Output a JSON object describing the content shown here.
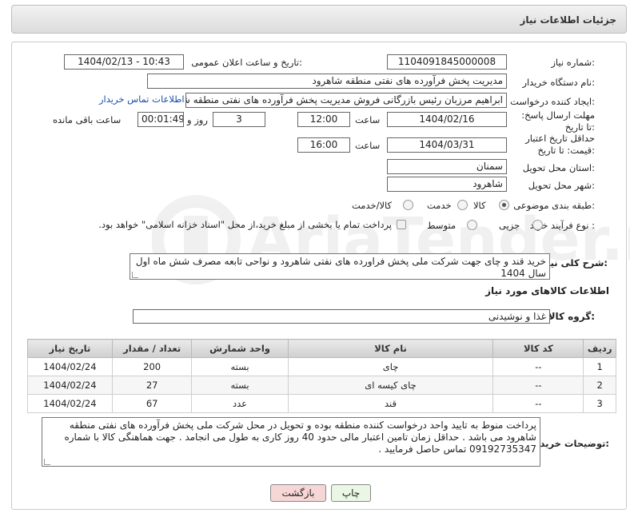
{
  "header": {
    "title": "جزئیات اطلاعات نیاز"
  },
  "watermark": {
    "text": "AriaTender.net"
  },
  "fields": {
    "need_number_label": "شماره نیاز:",
    "need_number": "1104091845000008",
    "announce_label": "تاریخ و ساعت اعلان عمومی:",
    "announce_value": "1404/02/13 - 10:43",
    "buyer_org_label": "نام دستگاه خریدار:",
    "buyer_org": "مدیریت پخش فرآورده های نفتی منطقه شاهرود",
    "creator_label": "ایجاد کننده درخواست:",
    "creator": "ابراهیم مرزبان رئیس بازرگانی فروش مدیریت پخش فرآورده های نفتی منطقه شا",
    "contact_link": "اطلاعات تماس خریدار",
    "deadline_label": "مهلت ارسال پاسخ: تا تاریخ:",
    "deadline_date": "1404/02/16",
    "time_label": "ساعت",
    "deadline_time": "12:00",
    "days_value": "3",
    "days_label": "روز و",
    "remaining_time": "00:01:49",
    "remaining_label": "ساعت باقی مانده",
    "validity_label": "حداقل تاریخ اعتبار قیمت: تا تاریخ:",
    "validity_date": "1404/03/31",
    "validity_time": "16:00",
    "province_label": "استان محل تحویل:",
    "province": "سمنان",
    "city_label": "شهر محل تحویل:",
    "city": "شاهرود",
    "category_label": "طبقه بندی موضوعی:",
    "category_options": [
      "کالا",
      "خدمت",
      "کالا/خدمت"
    ],
    "category_selected": "کالا",
    "process_label": "نوع فرآیند خرید :",
    "process_options": [
      "جزیی",
      "متوسط"
    ],
    "process_note": "پرداخت تمام یا بخشی از مبلغ خرید،از محل \"اسناد خزانه اسلامی\" خواهد بود.",
    "description_label": "شرح کلی نیاز:",
    "description": "خرید قند و چای جهت شرکت ملی پخش فراورده های نفتی شاهرود و نواحی تابعه مصرف شش ماه اول سال 1404",
    "goods_section_title": "اطلاعات کالاهای مورد نیاز",
    "goods_group_label": "گروه کالا:",
    "goods_group": "غذا و نوشیدنی",
    "buyer_notes_label": "توضیحات خریدار:",
    "buyer_notes": "پرداخت منوط به تایید واحد درخواست کننده منطقه بوده و تحویل در محل شرکت ملی پخش فرآورده های نفتی منطقه شاهرود می باشد . حداقل زمان تامین اعتبار مالی حدود 40 روز کاری به طول می انجامد . جهت هماهنگی کالا با شماره 09192735347 تماس حاصل فرمایید ."
  },
  "table": {
    "headers": [
      "ردیف",
      "کد کالا",
      "نام کالا",
      "واحد شمارش",
      "تعداد / مقدار",
      "تاریخ نیاز"
    ],
    "rows": [
      [
        "1",
        "--",
        "چای",
        "بسته",
        "200",
        "1404/02/24"
      ],
      [
        "2",
        "--",
        "چای کیسه ای",
        "بسته",
        "27",
        "1404/02/24"
      ],
      [
        "3",
        "--",
        "قند",
        "عدد",
        "67",
        "1404/02/24"
      ]
    ]
  },
  "buttons": {
    "print": "چاپ",
    "back": "بازگشت"
  },
  "colors": {
    "back_button": "#f7d6d6",
    "print_button": "#e9f7e4",
    "link": "#1a4fb0"
  }
}
